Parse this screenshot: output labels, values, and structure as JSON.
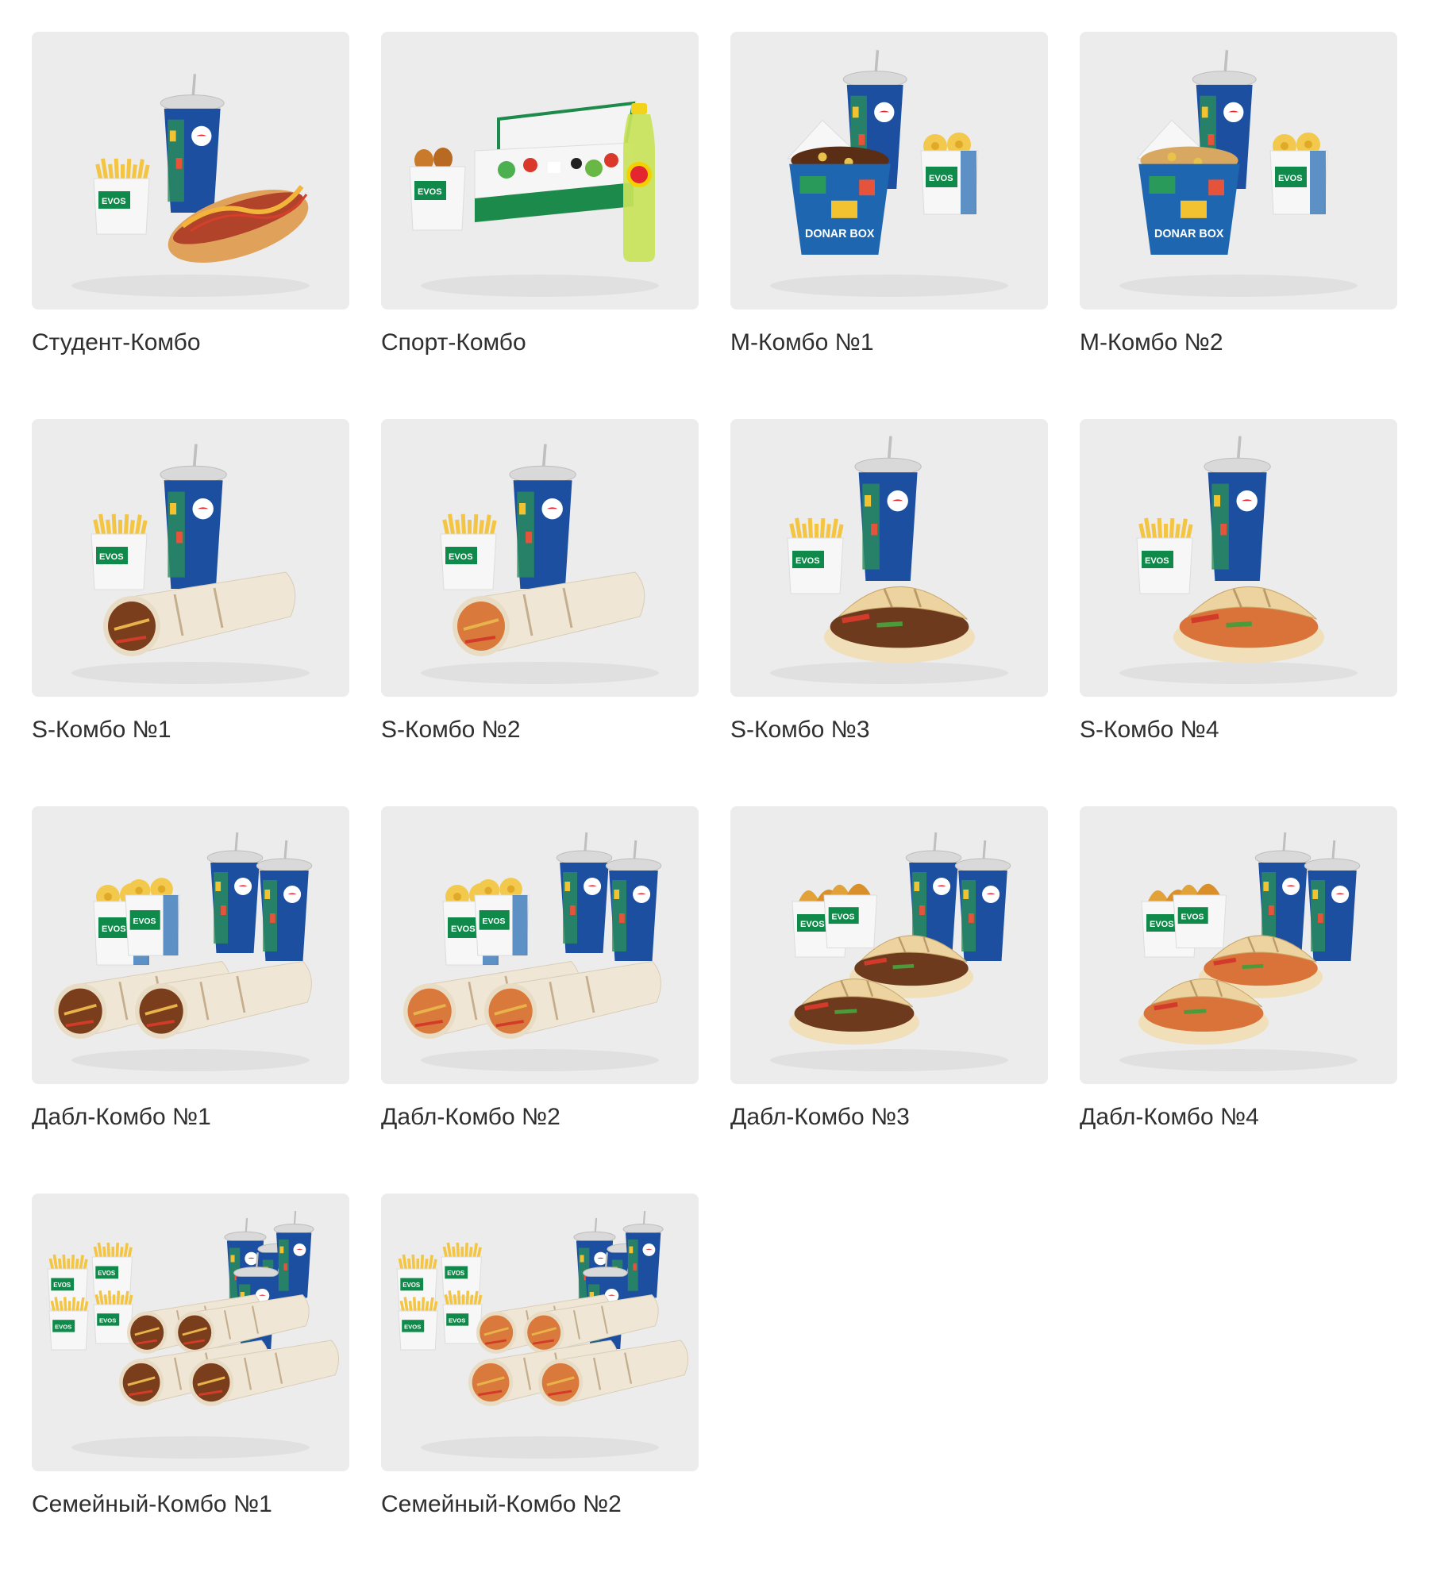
{
  "colors": {
    "page_background": "#ffffff",
    "card_background": "#ececec",
    "title_text": "#2f2f2f",
    "brand_green": "#0f8a4a",
    "pepsi_blue": "#1d4fa0"
  },
  "products": [
    {
      "title": "Студент-Комбо",
      "image": "combo-hotdog-fries-drink",
      "main": "hotdog",
      "side": "fries",
      "drink": "cup",
      "count": 1
    },
    {
      "title": "Спорт-Комбо",
      "image": "combo-salad-nuggets-tea",
      "main": "salad",
      "side": "nuggets",
      "drink": "bottle",
      "count": 1
    },
    {
      "title": "M-Комбо №1",
      "image": "combo-donar-box-rings-drink",
      "main": "box-meat",
      "side": "rings",
      "drink": "cup",
      "count": 1
    },
    {
      "title": "M-Комбо №2",
      "image": "combo-donar-box-chicken-drink",
      "main": "box-chicken",
      "side": "rings",
      "drink": "cup",
      "count": 1
    },
    {
      "title": "S-Комбо №1",
      "image": "combo-wrap-beef-fries-drink",
      "main": "wrap-beef",
      "side": "fries",
      "drink": "cup",
      "count": 1
    },
    {
      "title": "S-Комбо №2",
      "image": "combo-wrap-chicken-fries-drink",
      "main": "wrap-chicken",
      "side": "fries",
      "drink": "cup",
      "count": 1
    },
    {
      "title": "S-Комбо №3",
      "image": "combo-pita-beef-fries-drink",
      "main": "pita-beef",
      "side": "fries",
      "drink": "cup",
      "count": 1
    },
    {
      "title": "S-Комбо №4",
      "image": "combo-pita-chicken-fries-drink",
      "main": "pita-chicken",
      "side": "fries",
      "drink": "cup",
      "count": 1
    },
    {
      "title": "Дабл-Комбо №1",
      "image": "combo-double-wrap-beef",
      "main": "wrap-beef",
      "side": "rings",
      "drink": "cup",
      "count": 2
    },
    {
      "title": "Дабл-Комбо №2",
      "image": "combo-double-wrap-chicken",
      "main": "wrap-chicken",
      "side": "rings",
      "drink": "cup",
      "count": 2
    },
    {
      "title": "Дабл-Комбо №3",
      "image": "combo-double-pita-beef",
      "main": "pita-beef",
      "side": "wedges",
      "drink": "cup",
      "count": 2
    },
    {
      "title": "Дабл-Комбо №4",
      "image": "combo-double-pita-chicken",
      "main": "pita-chicken",
      "side": "wedges",
      "drink": "cup",
      "count": 2
    },
    {
      "title": "Семейный-Комбо №1",
      "image": "combo-family-wrap-beef",
      "main": "wrap-beef",
      "side": "fries",
      "drink": "cup",
      "count": 4
    },
    {
      "title": "Семейный-Комбо №2",
      "image": "combo-family-wrap-chicken",
      "main": "wrap-chicken",
      "side": "fries",
      "drink": "cup",
      "count": 4
    }
  ]
}
